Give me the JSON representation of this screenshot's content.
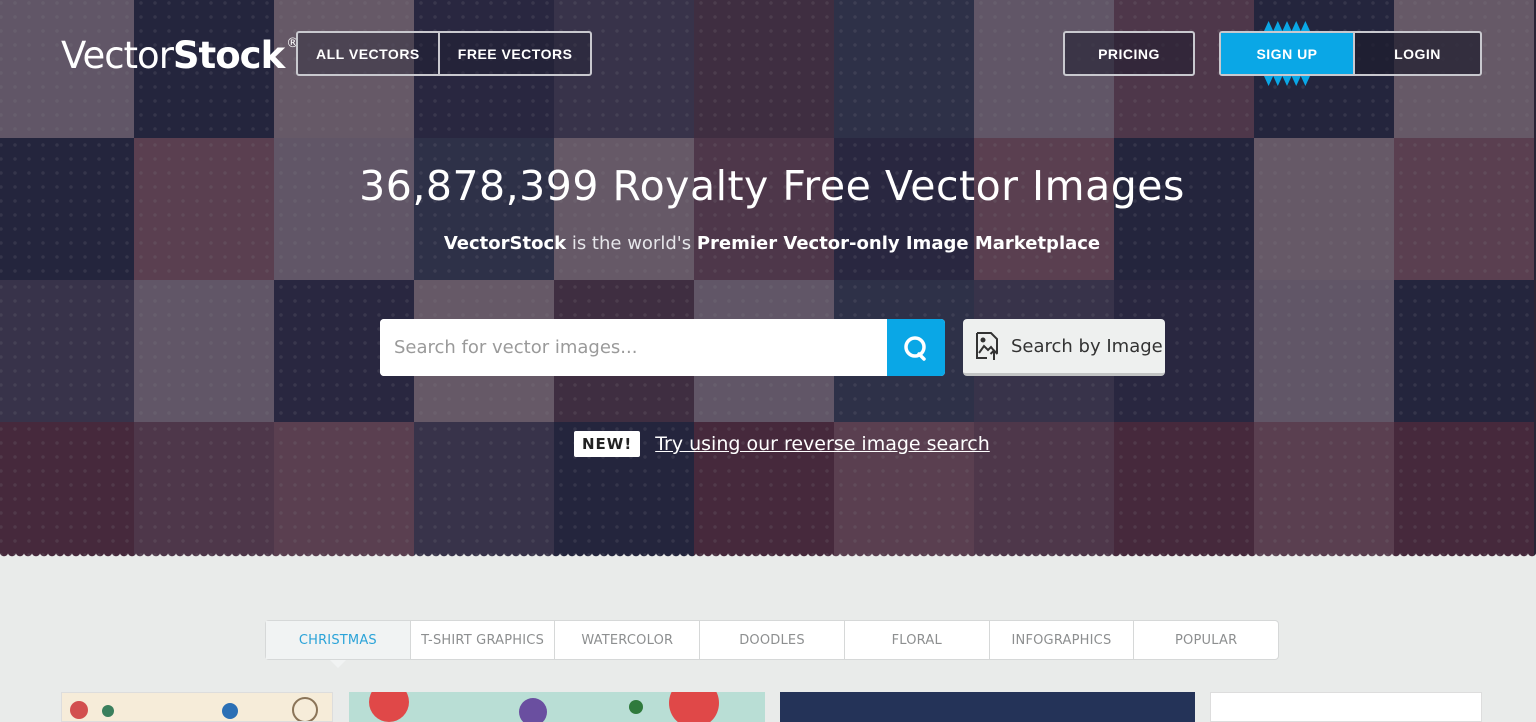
{
  "header": {
    "logo": {
      "light": "Vector",
      "bold": "Stock",
      "mark": "®"
    },
    "nav": {
      "all_vectors": "ALL VECTORS",
      "free_vectors": "FREE VECTORS"
    },
    "pricing": "PRICING",
    "signup": "SIGN UP",
    "login": "LOGIN"
  },
  "hero": {
    "headline": "36,878,399 Royalty Free Vector Images",
    "sub_brand": "VectorStock",
    "sub_mid": " is the world's ",
    "sub_bold": "Premier Vector-only Image Marketplace"
  },
  "search": {
    "placeholder": "Search for vector images...",
    "value": "",
    "submit_icon": "search-icon",
    "by_image_label": "Search by Image",
    "by_image_icon": "image-upload-icon"
  },
  "promo": {
    "badge": "NEW!",
    "link": "Try using our reverse image search"
  },
  "tabs": [
    {
      "label": "CHRISTMAS",
      "active": true
    },
    {
      "label": "T-SHIRT GRAPHICS",
      "active": false
    },
    {
      "label": "WATERCOLOR",
      "active": false
    },
    {
      "label": "DOODLES",
      "active": false
    },
    {
      "label": "FLORAL",
      "active": false
    },
    {
      "label": "INFOGRAPHICS",
      "active": false
    },
    {
      "label": "POPULAR",
      "active": false
    }
  ],
  "colors": {
    "accent": "#0aa7e6",
    "active_tab": "#2ba3d8",
    "page_bg": "#e9ebea"
  }
}
